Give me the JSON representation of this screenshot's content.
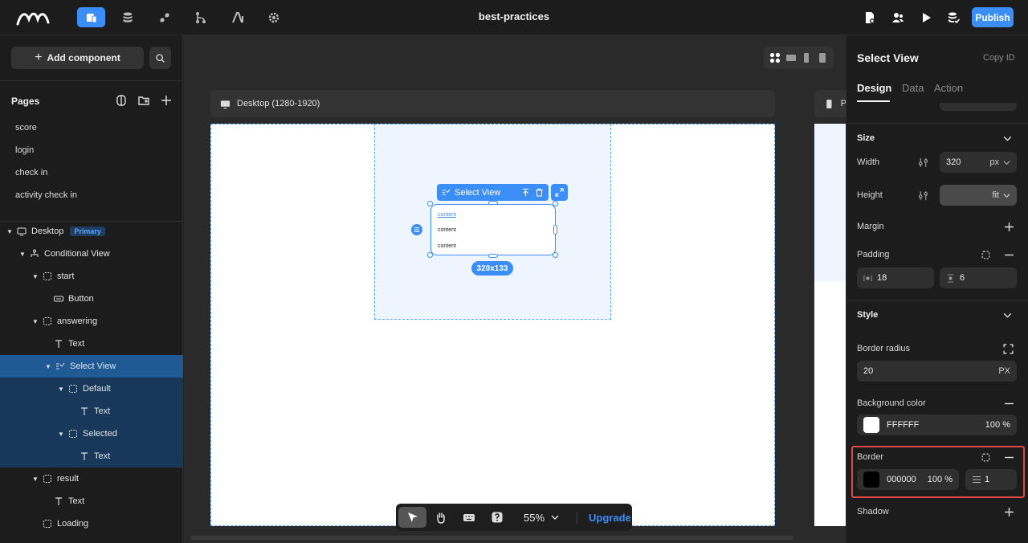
{
  "topbar": {
    "project_title": "best-practices",
    "publish_label": "Publish",
    "nav_icons": [
      "pages-icon",
      "database-icon",
      "api-icon",
      "logic-icon",
      "ai-icon",
      "settings-icon"
    ],
    "right_icons": [
      "page-settings-icon",
      "users-icon",
      "preview-play-icon",
      "database-check-icon"
    ]
  },
  "left": {
    "add_component_label": "Add component",
    "pages_title": "Pages",
    "pages": [
      "score",
      "login",
      "check in",
      "activity check in"
    ],
    "tree": {
      "desktop": "Desktop",
      "primary_badge": "Primary",
      "conditional_view": "Conditional View",
      "start": "start",
      "button": "Button",
      "answering": "answering",
      "text1": "Text",
      "select_view": "Select View",
      "default": "Default",
      "text2": "Text",
      "selected": "Selected",
      "text3": "Text",
      "result": "result",
      "text4": "Text",
      "loading": "Loading"
    }
  },
  "canvas": {
    "frame_label": "Desktop (1280-1920)",
    "frame2_label": "P",
    "select_view_label": "Select View",
    "options": [
      "content",
      "content",
      "content"
    ],
    "size_label": "320x133",
    "zoom": "55%",
    "upgrade_label": "Upgrade"
  },
  "right": {
    "title": "Select View",
    "copy_id": "Copy ID",
    "tabs": [
      "Design",
      "Data",
      "Action"
    ],
    "size": {
      "title": "Size",
      "width_label": "Width",
      "width_value": "320",
      "width_unit": "px",
      "height_label": "Height",
      "height_value": "fit",
      "margin_label": "Margin",
      "padding_label": "Padding",
      "padding_h": "18",
      "padding_v": "6"
    },
    "style": {
      "title": "Style",
      "border_radius_label": "Border radius",
      "border_radius_value": "20",
      "border_radius_unit": "PX",
      "bg_label": "Background color",
      "bg_hex": "FFFFFF",
      "bg_opacity": "100 %",
      "bg_color": "#FFFFFF",
      "border_label": "Border",
      "border_hex": "000000",
      "border_opacity": "100 %",
      "border_color": "#000000",
      "border_width": "1",
      "shadow_label": "Shadow"
    }
  },
  "colors": {
    "accent": "#3A8EF6",
    "highlight": "#E04848"
  }
}
